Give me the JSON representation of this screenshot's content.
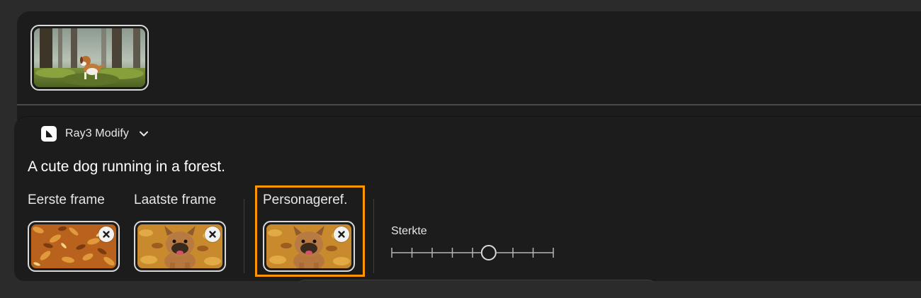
{
  "model": {
    "name": "Ray3 Modify",
    "logo_icon": "luma-logo-icon",
    "dropdown_icon": "chevron-down-icon"
  },
  "prompt": {
    "text": "A cute dog running in a forest."
  },
  "frames": {
    "first_label": "Eerste frame",
    "last_label": "Laatste frame",
    "character_ref_label": "Personageref."
  },
  "strength": {
    "label": "Sterkte",
    "value_percent": 60,
    "tick_count": 9
  },
  "colors": {
    "highlight": "#ff9800",
    "panel": "#1c1c1c",
    "background": "#2b2b2b"
  }
}
